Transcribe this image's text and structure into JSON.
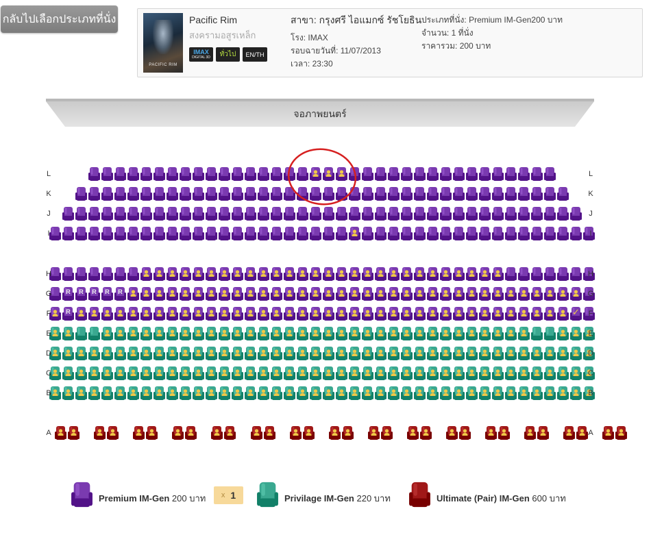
{
  "back_button": {
    "label": "กลับไปเลือกประเภทที่นั่ง"
  },
  "movie": {
    "poster_title": "PACIFIC RIM",
    "title": "Pacific Rim",
    "thai_title": "สงครามอสูรเหล็ก",
    "badges": {
      "imax_top": "IMAX",
      "imax_bottom": "DIGITAL 3D",
      "rating": "ทั่วไป",
      "language": "EN/TH"
    }
  },
  "showtime": {
    "branch": "สาขา: กรุงศรี ไอแมกซ์ รัชโยธิน",
    "theater": "โรง: IMAX",
    "date": "รอบฉายวันที่: 11/07/2013",
    "time": "เวลา: 23:30"
  },
  "ticket": {
    "seat_type": "ประเภทที่นั่ง: Premium IM-Gen200 บาท",
    "quantity": "จำนวน: 1 ที่นั่ง",
    "total": "ราคารวม: 200 บาท"
  },
  "screen_label": "จอภาพยนตร์",
  "colors": {
    "premium": "#7a3ab0",
    "privilege": "#3aa890",
    "ultimate": "#a01818",
    "occupied_mark": "#f0c848",
    "annotation_circle": "#d62020"
  },
  "seat_map": {
    "rows": [
      {
        "label": "L",
        "type": "premium",
        "count": 36,
        "occupied": [
          17,
          18,
          19
        ]
      },
      {
        "label": "K",
        "type": "premium",
        "count": 38,
        "occupied": []
      },
      {
        "label": "J",
        "type": "premium",
        "count": 40,
        "occupied": []
      },
      {
        "label": "I",
        "type": "premium",
        "count": 42,
        "occupied": [
          23
        ]
      },
      {
        "label": "H",
        "type": "premium",
        "count": 42,
        "occupied": [
          7,
          8,
          9,
          10,
          11,
          12,
          13,
          14,
          15,
          16,
          17,
          18,
          19,
          20,
          21,
          22,
          23,
          24,
          25,
          26,
          27,
          28,
          29,
          30,
          31,
          32,
          33,
          34
        ]
      },
      {
        "label": "G",
        "type": "premium",
        "count": 42,
        "reserved": [
          1,
          2,
          3,
          4,
          5
        ],
        "occupied": [
          6,
          7,
          8,
          9,
          10,
          11,
          12,
          13,
          14,
          15,
          16,
          17,
          18,
          19,
          20,
          21,
          22,
          23,
          24,
          25,
          26,
          27,
          28,
          29,
          30,
          31,
          32,
          33,
          34,
          35,
          36,
          37,
          38,
          39,
          40
        ]
      },
      {
        "label": "F",
        "type": "premium",
        "count": 42,
        "reserved": [
          1
        ],
        "occupied": [
          0,
          2,
          3,
          4,
          5,
          6,
          7,
          8,
          9,
          10,
          11,
          12,
          13,
          14,
          15,
          16,
          17,
          18,
          19,
          20,
          21,
          22,
          23,
          24,
          25,
          26,
          27,
          28,
          29,
          30,
          31,
          32,
          33,
          34,
          35,
          36,
          37,
          38,
          39
        ],
        "selected": [
          40
        ]
      },
      {
        "label": "E",
        "type": "privilege",
        "count": 42,
        "occupied": [
          0,
          1,
          4,
          5,
          6,
          7,
          8,
          9,
          10,
          11,
          12,
          13,
          14,
          15,
          16,
          17,
          18,
          19,
          20,
          21,
          22,
          23,
          24,
          25,
          26,
          27,
          28,
          29,
          30,
          31,
          32,
          33,
          34,
          35,
          36,
          39,
          40,
          41
        ]
      },
      {
        "label": "D",
        "type": "privilege",
        "count": 42,
        "occupied": "all"
      },
      {
        "label": "C",
        "type": "privilege",
        "count": 42,
        "occupied": "all"
      },
      {
        "label": "B",
        "type": "privilege",
        "count": 42,
        "occupied": "all"
      },
      {
        "label": "A",
        "type": "ultimate",
        "count": 30,
        "paired": true,
        "occupied": "all"
      }
    ],
    "reserved_mark": "R",
    "selected_mark": "✓"
  },
  "legend": [
    {
      "name": "Premium IM-Gen",
      "price": "200 บาท",
      "type": "premium"
    },
    {
      "name": "Privilage IM-Gen",
      "price": "220 บาท",
      "type": "privilege"
    },
    {
      "name": "Ultimate (Pair) IM-Gen",
      "price": "600 บาท",
      "type": "ultimate"
    }
  ],
  "ticket_counter": {
    "multiplier": "x",
    "count": "1"
  }
}
